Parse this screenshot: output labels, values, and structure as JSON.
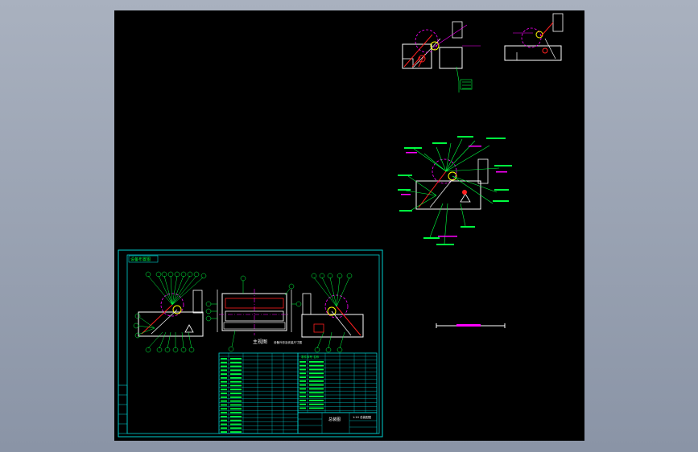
{
  "viewer": {
    "background": "#98a0b0",
    "canvas_color": "#000000"
  },
  "sheet": {
    "border_color": "#00d0d0",
    "title_tag": "设备布置图",
    "main_view_caption": "主视图",
    "side_caption": "设备外形及安装尺寸图",
    "title_block_name": "总装图",
    "drawing_number": "1:10 总装配图",
    "parts_list_label": "零件序号  名称"
  },
  "callouts": {
    "color_green": "#00ff40",
    "color_magenta": "#ff00ff",
    "color_red": "#ff2020",
    "color_white": "#ffffff",
    "color_yellow": "#ffff00"
  }
}
